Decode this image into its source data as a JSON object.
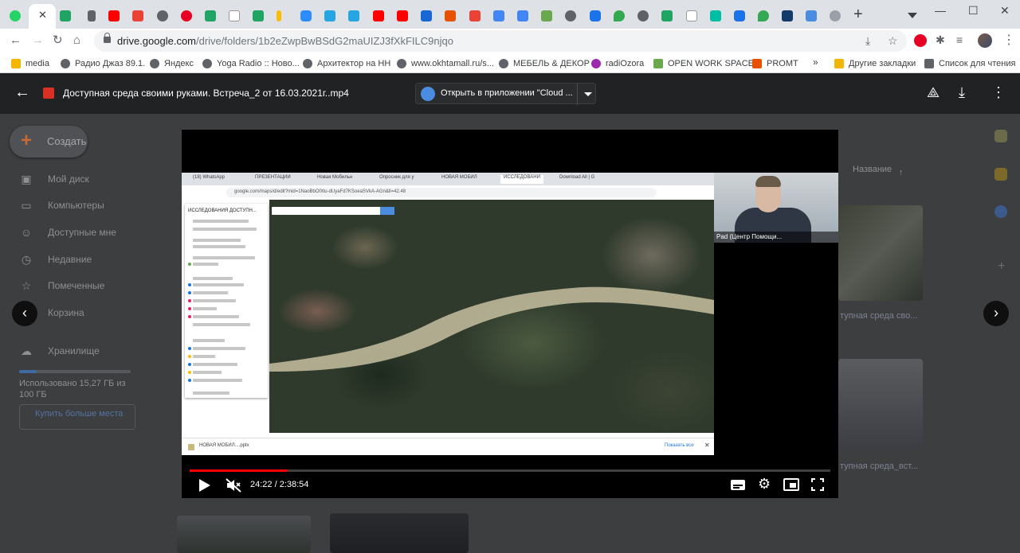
{
  "browser": {
    "url_domain": "drive.google.com",
    "url_path": "/drive/folders/1b2eZwpBwBSdG2maUIZJ3fXkFILC9njqo",
    "bookmarks": [
      {
        "label": "media",
        "color": "#f2b600"
      },
      {
        "label": "Радио Джаз 89.1.",
        "color": "#5f6368"
      },
      {
        "label": "Яндекс",
        "color": "#5f6368"
      },
      {
        "label": "Yoga Radio :: Ново...",
        "color": "#5f6368"
      },
      {
        "label": "Архитектор на НН",
        "color": "#5f6368"
      },
      {
        "label": "www.okhtamall.ru/s...",
        "color": "#5f6368"
      },
      {
        "label": "МЕБЕЛЬ & ДЕКОР",
        "color": "#5f6368"
      },
      {
        "label": "radiOzora",
        "color": "#9c27b0"
      },
      {
        "label": "OPEN WORK SPACE",
        "color": "#6aa84f"
      },
      {
        "label": "PROMT",
        "color": "#e65100"
      }
    ],
    "bookmarks_more": "»",
    "other_bookmarks": "Другие закладки",
    "reading_list": "Список для чтения"
  },
  "drive": {
    "create_label": "Создать",
    "nav": [
      {
        "label": "Мой диск",
        "icon": "drive-icon"
      },
      {
        "label": "Компьютеры",
        "icon": "computer-icon"
      },
      {
        "label": "Доступные мне",
        "icon": "people-icon"
      },
      {
        "label": "Недавние",
        "icon": "clock-icon"
      },
      {
        "label": "Помеченные",
        "icon": "star-icon"
      },
      {
        "label": "Корзина",
        "icon": "trash-icon"
      }
    ],
    "storage_label": "Хранилище",
    "storage_used": "Использовано 15,27 ГБ из 100 ГБ",
    "buy_more": "Купить больше места",
    "sort_label": "Название",
    "file_caption_1": "тупная среда сво...",
    "file_caption_2": "тупная среда_вст..."
  },
  "viewer": {
    "file_title": "Доступная среда своими руками. Встреча_2 от 16.03.2021г..mp4",
    "open_with": "Открыть в приложении \"Cloud ...",
    "video": {
      "inner_tabs": [
        "(18) WhatsApp",
        "ПРЕЗЕНТАЦИИ",
        "Новая Мобильн",
        "Опросник для у",
        "НОВАЯ МОБИЛ",
        "ИССЛЕДОВАНИ",
        "Download All | G"
      ],
      "inner_url": "google.com/maps/d/edit?mid=1NaoBbO0ttu-dUyaFd7KSoeaSVkA-AGn&ll=42.48",
      "panel_title": "ИССЛЕДОВАНИЯ ДОСТУПН...",
      "download_name": "НОВАЯ МОБИЛ....pptx",
      "show_all": "Показать все",
      "webcam_name": "Pad (Центр Помощи...",
      "time_current": "24:22",
      "time_total": "2:38:54",
      "progress": 0.153
    }
  }
}
